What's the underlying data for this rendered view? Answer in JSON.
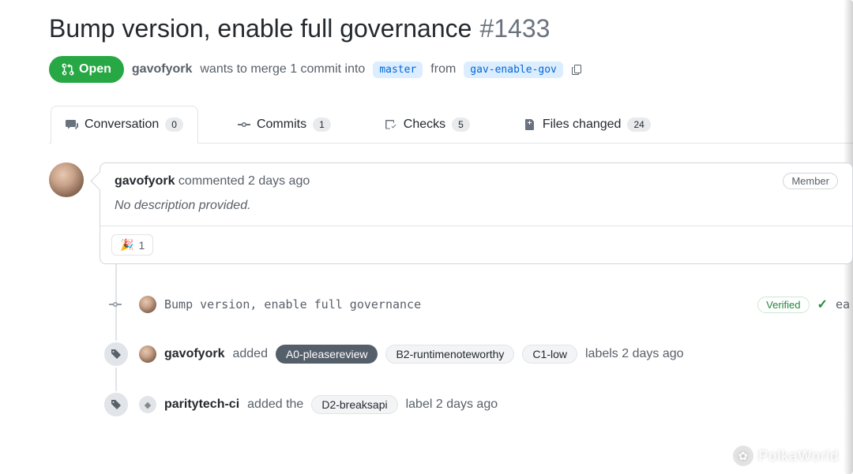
{
  "pr": {
    "title": "Bump version, enable full governance",
    "number": "#1433",
    "state": "Open",
    "author": "gavofyork",
    "merge_text_prefix": "wants to merge 1 commit into",
    "base_branch": "master",
    "merge_text_mid": "from",
    "head_branch": "gav-enable-gov"
  },
  "tabs": {
    "conversation": {
      "label": "Conversation",
      "count": "0"
    },
    "commits": {
      "label": "Commits",
      "count": "1"
    },
    "checks": {
      "label": "Checks",
      "count": "5"
    },
    "files": {
      "label": "Files changed",
      "count": "24"
    }
  },
  "comment": {
    "author": "gavofyork",
    "verb": "commented",
    "time": "2 days ago",
    "role": "Member",
    "body": "No description provided.",
    "reaction_emoji": "🎉",
    "reaction_count": "1"
  },
  "commit": {
    "message": "Bump version, enable full governance",
    "verified": "Verified",
    "check_glyph": "✓",
    "sha_frag": "ea"
  },
  "event_labels_1": {
    "actor": "gavofyork",
    "verb": "added",
    "labels": [
      "A0-pleasereview",
      "B2-runtimenoteworthy",
      "C1-low"
    ],
    "suffix": "labels 2 days ago"
  },
  "event_labels_2": {
    "actor": "paritytech-ci",
    "verb": "added the",
    "labels": [
      "D2-breaksapi"
    ],
    "suffix": "label 2 days ago"
  },
  "watermark": "PolkaWorld"
}
